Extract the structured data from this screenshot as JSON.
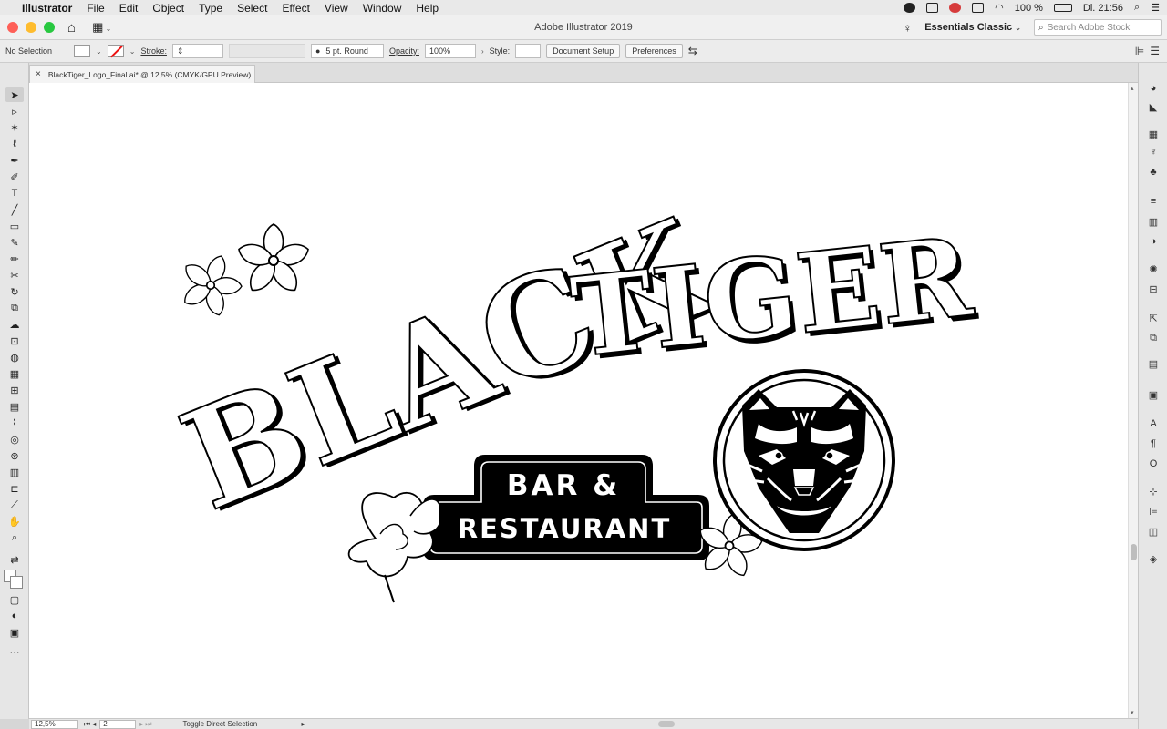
{
  "menubar": {
    "app": "Illustrator",
    "items": [
      "File",
      "Edit",
      "Object",
      "Type",
      "Select",
      "Effect",
      "View",
      "Window",
      "Help"
    ],
    "battery": "100 %",
    "clock": "Di. 21:56"
  },
  "window": {
    "title": "Adobe Illustrator 2019",
    "workspace": "Essentials Classic",
    "stock_search_placeholder": "Search Adobe Stock"
  },
  "controlbar": {
    "selection": "No Selection",
    "stroke_label": "Stroke:",
    "brush": "5 pt. Round",
    "opacity_label": "Opacity:",
    "opacity_value": "100%",
    "style_label": "Style:",
    "document_setup": "Document Setup",
    "preferences": "Preferences"
  },
  "document": {
    "tab_title": "BlackTiger_Logo_Final.ai* @ 12,5% (CMYK/GPU Preview)"
  },
  "artwork": {
    "word1": "BLACK",
    "word2": "TIGER",
    "line1": "BAR &",
    "line2": "RESTAURANT"
  },
  "statusbar": {
    "zoom": "12,5%",
    "artboard": "2",
    "tool_hint": "Toggle Direct Selection"
  },
  "icons": {
    "apple": "apple-icon",
    "home": "home-icon",
    "search": "search-icon",
    "lightbulb": "lightbulb-icon"
  }
}
